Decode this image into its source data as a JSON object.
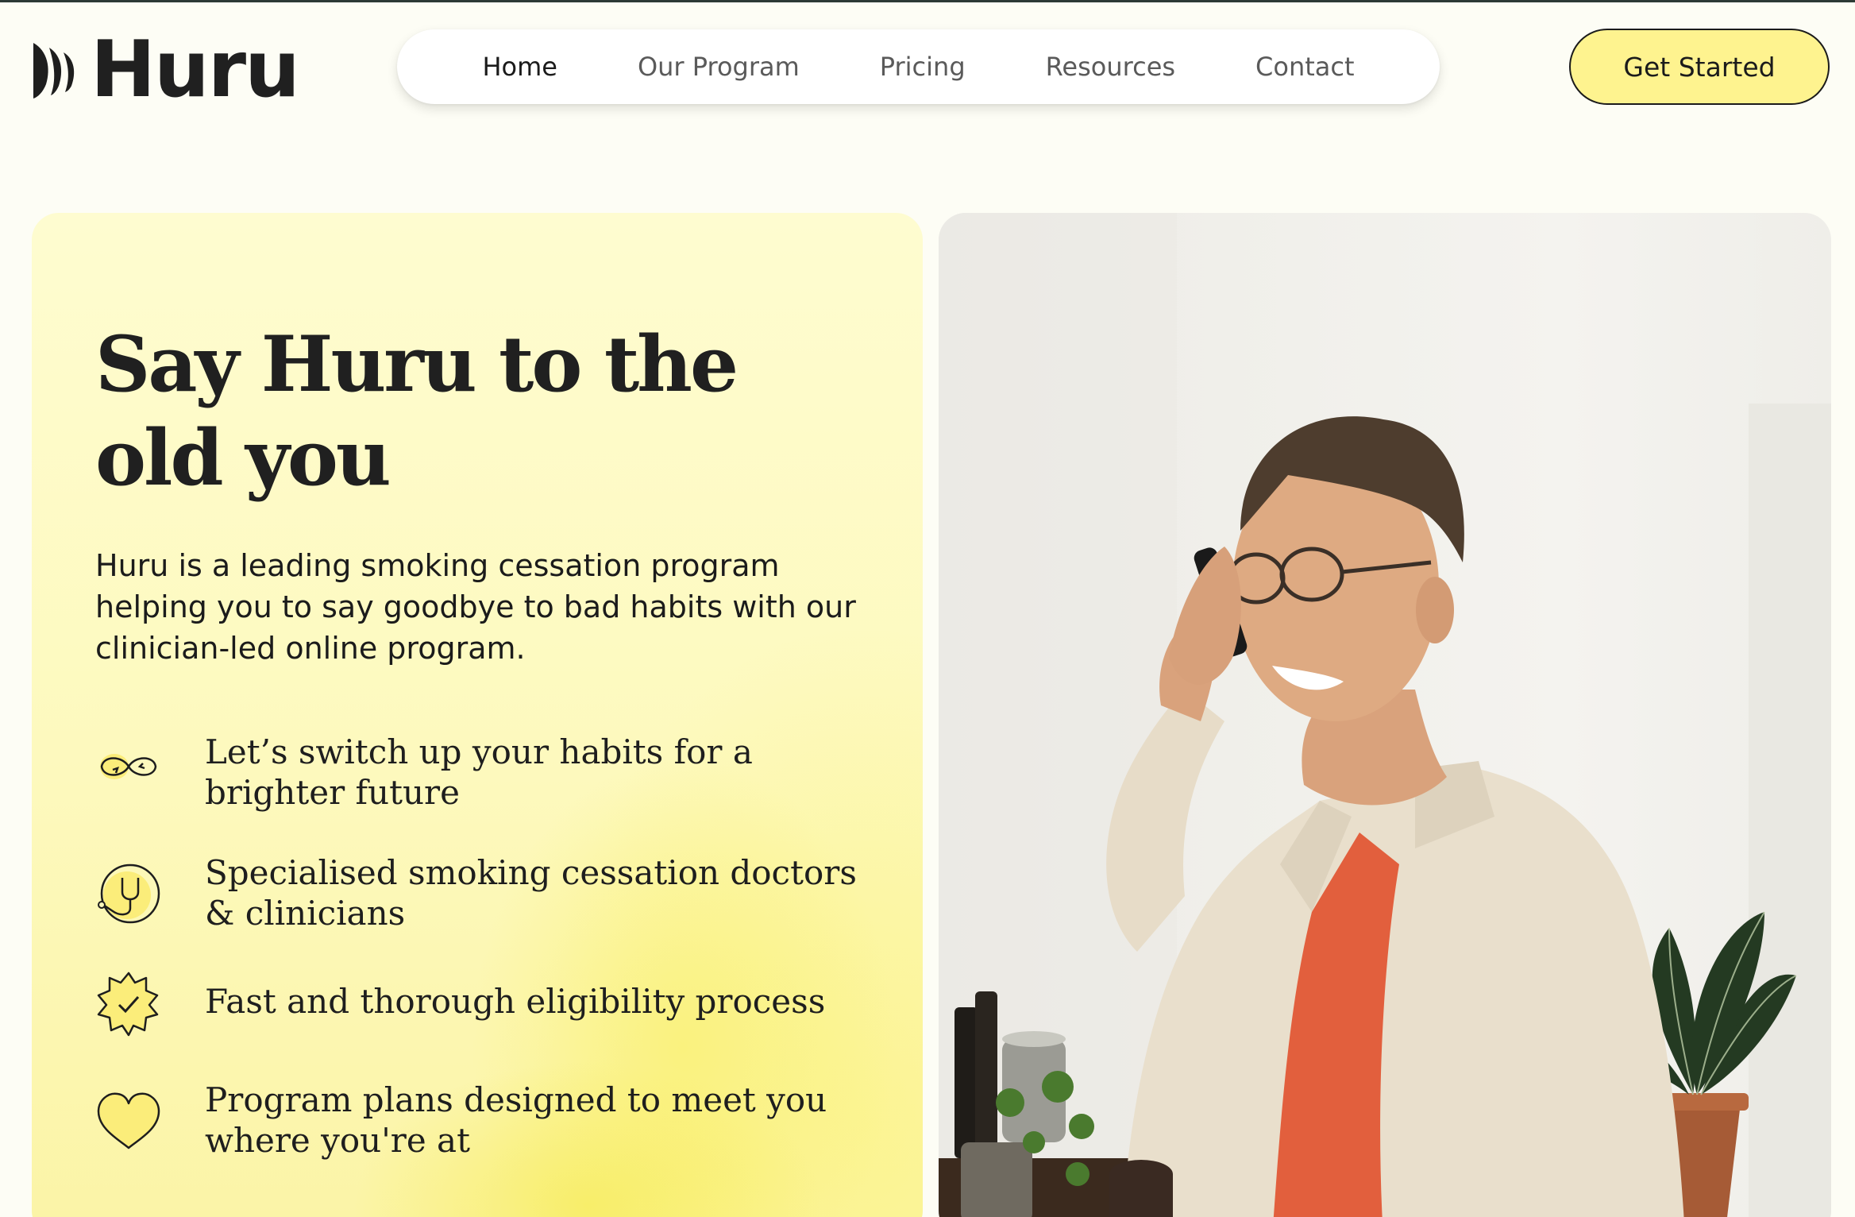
{
  "brand": {
    "name": "Huru",
    "logo_icon": "huru-wave-mark"
  },
  "nav": {
    "items": [
      {
        "label": "Home",
        "active": true
      },
      {
        "label": "Our Program",
        "active": false
      },
      {
        "label": "Pricing",
        "active": false
      },
      {
        "label": "Resources",
        "active": false
      },
      {
        "label": "Contact",
        "active": false
      }
    ]
  },
  "cta": {
    "label": "Get Started"
  },
  "hero": {
    "title": "Say Huru to the old you",
    "description": "Huru is a leading smoking cessation program helping you to say goodbye to bad habits with our clinician-led online program.",
    "features": [
      {
        "icon": "infinity-arrows-icon",
        "text": "Let’s switch up your habits for a brighter future"
      },
      {
        "icon": "stethoscope-icon",
        "text": "Specialised smoking cessation doctors & clinicians"
      },
      {
        "icon": "badge-check-icon",
        "text": "Fast and thorough eligibility process"
      },
      {
        "icon": "heart-icon",
        "text": "Program plans designed to meet you where you're at"
      }
    ],
    "image": "smiling man with glasses talking on phone in kitchen"
  },
  "colors": {
    "background": "#fdfdf5",
    "accent_yellow": "#fef38f",
    "card_yellow": "#fdf9bd",
    "text": "#1b1b1b"
  }
}
